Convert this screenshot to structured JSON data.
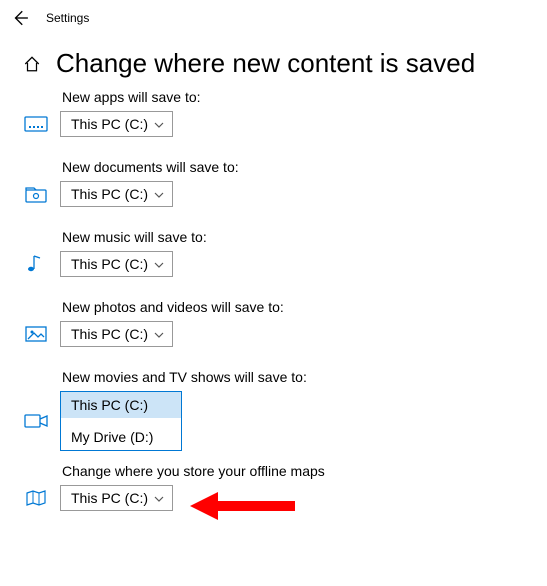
{
  "window": {
    "title": "Settings"
  },
  "page": {
    "title": "Change where new content is saved"
  },
  "settings": [
    {
      "label": "New apps will save to:",
      "value": "This PC (C:)",
      "icon": "apps"
    },
    {
      "label": "New documents will save to:",
      "value": "This PC (C:)",
      "icon": "documents"
    },
    {
      "label": "New music will save to:",
      "value": "This PC (C:)",
      "icon": "music"
    },
    {
      "label": "New photos and videos will save to:",
      "value": "This PC (C:)",
      "icon": "photos"
    },
    {
      "label": "New movies and TV shows will save to:",
      "value": "This PC (C:)",
      "icon": "movies",
      "open": true,
      "options": [
        "This PC (C:)",
        "My Drive (D:)"
      ]
    }
  ],
  "maps": {
    "label": "Change where you store your offline maps",
    "value": "This PC (C:)"
  },
  "colors": {
    "accent": "#0078d4",
    "arrow": "#ff0000"
  }
}
